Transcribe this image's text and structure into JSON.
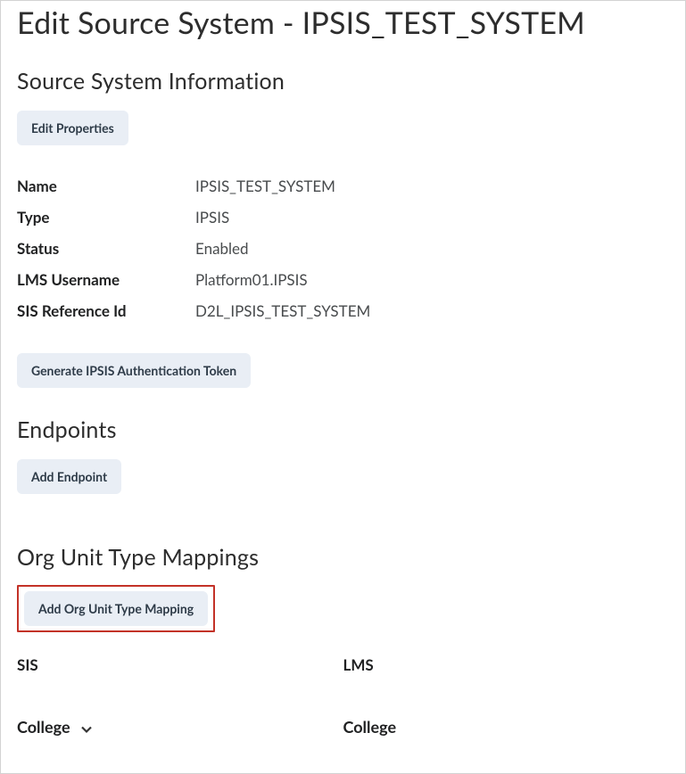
{
  "page_title": "Edit Source System - IPSIS_TEST_SYSTEM",
  "source_info": {
    "title": "Source System Information",
    "edit_button": "Edit Properties",
    "rows": [
      {
        "label": "Name",
        "value": "IPSIS_TEST_SYSTEM"
      },
      {
        "label": "Type",
        "value": "IPSIS"
      },
      {
        "label": "Status",
        "value": "Enabled"
      },
      {
        "label": "LMS Username",
        "value": "Platform01.IPSIS"
      },
      {
        "label": "SIS Reference Id",
        "value": "D2L_IPSIS_TEST_SYSTEM"
      }
    ],
    "generate_token_button": "Generate IPSIS Authentication Token"
  },
  "endpoints": {
    "title": "Endpoints",
    "add_button": "Add Endpoint"
  },
  "mappings": {
    "title": "Org Unit Type Mappings",
    "add_button": "Add Org Unit Type Mapping",
    "headers": {
      "sis": "SIS",
      "lms": "LMS"
    },
    "row1": {
      "sis": "College",
      "lms": "College"
    }
  }
}
